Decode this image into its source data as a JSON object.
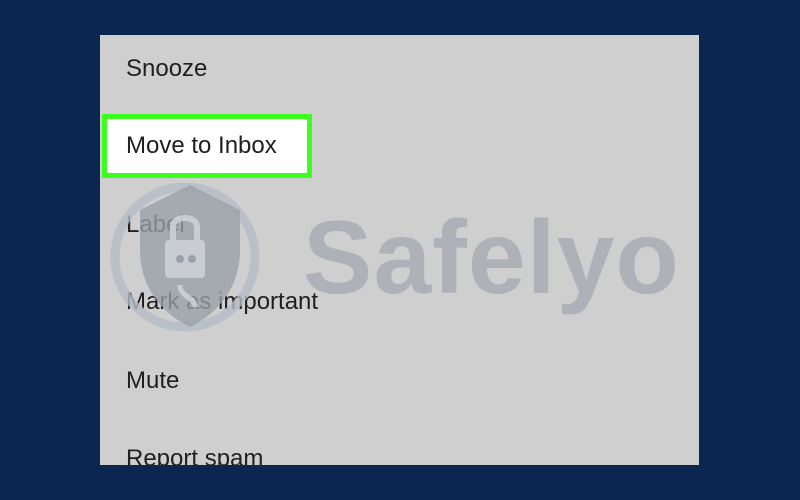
{
  "menu": {
    "items": [
      {
        "label": "Snooze"
      },
      {
        "label": "Move to Inbox"
      },
      {
        "label": "Label"
      },
      {
        "label": "Mark as important"
      },
      {
        "label": "Mute"
      },
      {
        "label": "Report spam"
      }
    ]
  },
  "watermark": {
    "text": "Safelyo",
    "icon": "shield-lock-logo-icon"
  },
  "colors": {
    "background": "#0b2650",
    "panel": "#cfcfcf",
    "highlight_border": "#3cff1e",
    "watermark": "#a5a9b1"
  }
}
